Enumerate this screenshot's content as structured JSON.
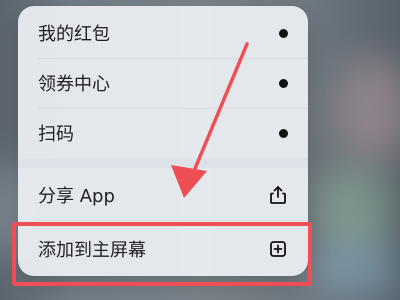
{
  "menu": {
    "items": [
      {
        "label": "我的红包",
        "icon": "dot-icon"
      },
      {
        "label": "领券中心",
        "icon": "dot-icon"
      },
      {
        "label": "扫码",
        "icon": "dot-icon"
      },
      {
        "label": "分享 App",
        "icon": "share-icon"
      },
      {
        "label": "添加到主屏幕",
        "icon": "add-to-home-icon"
      }
    ]
  },
  "colors": {
    "annotation_red": "#ef4e55",
    "menu_background": "#eef1f5"
  }
}
